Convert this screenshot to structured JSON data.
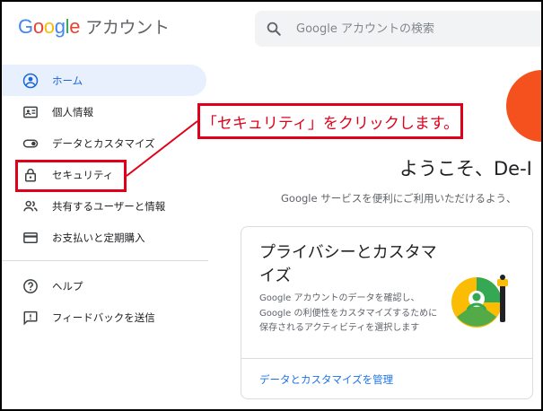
{
  "header": {
    "logo_letters": [
      "G",
      "o",
      "o",
      "g",
      "l",
      "e"
    ],
    "product_name": "アカウント",
    "search_placeholder": "Google アカウントの検索"
  },
  "sidebar": {
    "items": [
      {
        "label": "ホーム",
        "icon": "account-circle-icon",
        "active": true
      },
      {
        "label": "個人情報",
        "icon": "id-card-icon",
        "active": false
      },
      {
        "label": "データとカスタマイズ",
        "icon": "toggle-icon",
        "active": false
      },
      {
        "label": "セキュリティ",
        "icon": "lock-icon",
        "active": false
      },
      {
        "label": "共有するユーザーと情報",
        "icon": "people-icon",
        "active": false
      },
      {
        "label": "お支払いと定期購入",
        "icon": "credit-card-icon",
        "active": false
      }
    ],
    "secondary_items": [
      {
        "label": "ヘルプ",
        "icon": "help-icon"
      },
      {
        "label": "フィードバックを送信",
        "icon": "feedback-icon"
      }
    ]
  },
  "annotation": {
    "text": "「セキュリティ」をクリックします。",
    "color": "#e1001a"
  },
  "main": {
    "welcome": "ようこそ、De-I",
    "subtitle": "Google サービスを便利にご利用いただけるよう、",
    "card": {
      "title": "プライバシーとカスタマイズ",
      "description": "Google アカウントのデータを確認し、Google の利便性をカスタマイズするために保存されるアクティビティを選択します",
      "link": "データとカスタマイズを管理"
    }
  },
  "colors": {
    "accent": "#1a73e8",
    "active_bg": "#e8f0fe",
    "avatar": "#f4511e"
  }
}
